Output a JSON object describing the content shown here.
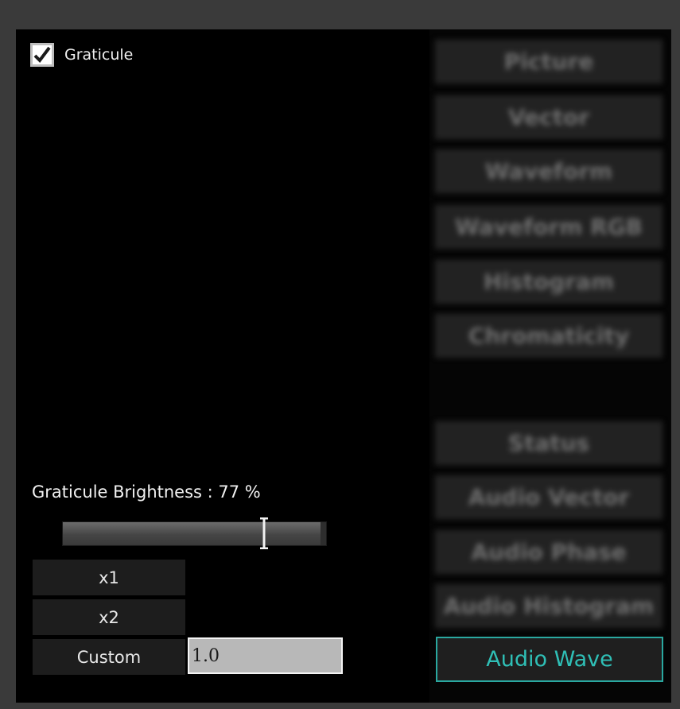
{
  "graticule": {
    "label": "Graticule",
    "checked": true
  },
  "side_buttons": {
    "picture": "Picture",
    "vector": "Vector",
    "waveform": "Waveform",
    "waveform_rgb": "Waveform RGB",
    "histogram": "Histogram",
    "chromaticity": "Chromaticity",
    "status": "Status",
    "audio_vector": "Audio Vector",
    "audio_phase": "Audio Phase",
    "audio_histogram": "Audio Histogram",
    "audio_wave": "Audio Wave"
  },
  "brightness": {
    "label": "Graticule Brightness : 77 %",
    "value_percent": 77
  },
  "zoom": {
    "x1": "x1",
    "x2": "x2",
    "custom": "Custom",
    "custom_value": "1.0"
  },
  "colors": {
    "accent": "#2fbfb6",
    "panel_bg": "#000000",
    "button_bg": "#222222"
  }
}
